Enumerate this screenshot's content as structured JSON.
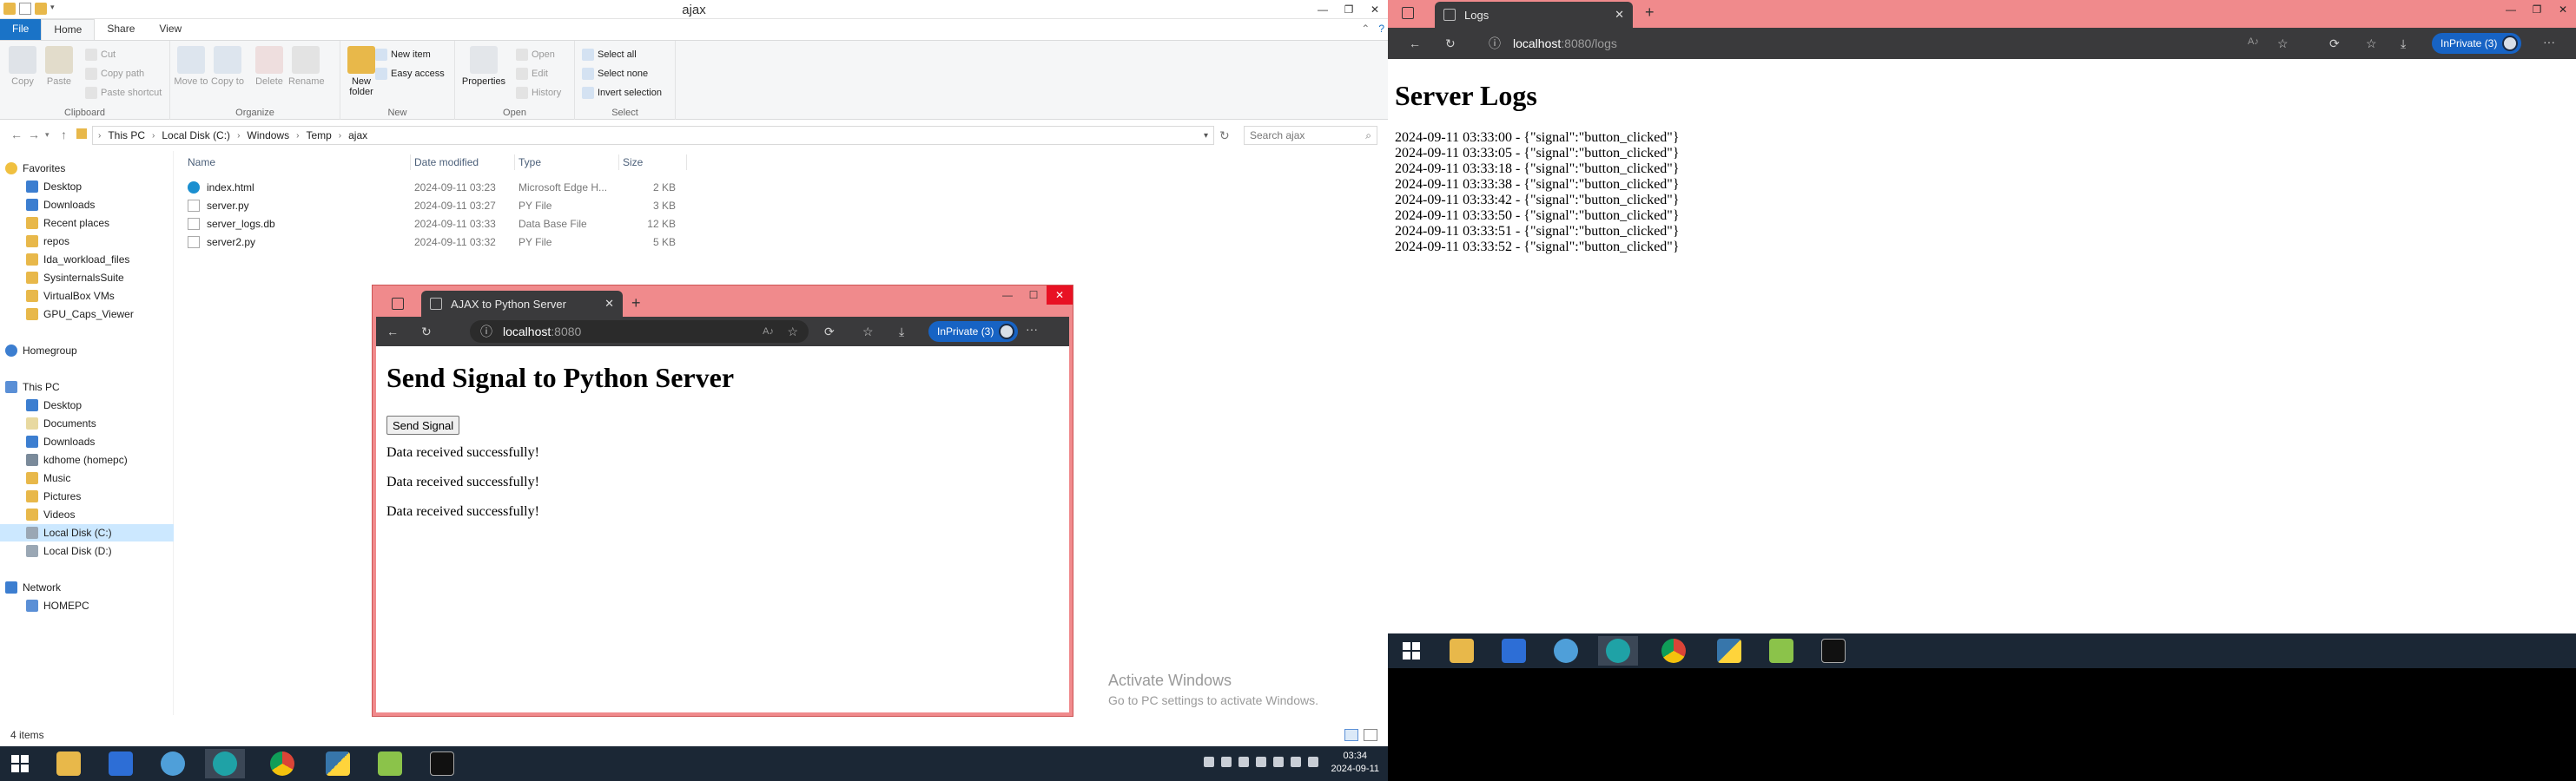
{
  "explorer": {
    "title": "ajax",
    "ribbon_tabs": [
      "File",
      "Home",
      "Share",
      "View"
    ],
    "clipboard": {
      "copy": "Copy",
      "paste": "Paste",
      "cut": "Cut",
      "copy_path": "Copy path",
      "paste_shortcut": "Paste shortcut",
      "label": "Clipboard"
    },
    "organize": {
      "move_to": "Move to",
      "copy_to": "Copy to",
      "delete": "Delete",
      "rename": "Rename",
      "label": "Organize"
    },
    "new_group": {
      "new_folder": "New folder",
      "new_item": "New item",
      "easy_access": "Easy access",
      "label": "New"
    },
    "open_group": {
      "properties": "Properties",
      "open": "Open",
      "edit": "Edit",
      "history": "History",
      "label": "Open"
    },
    "select_group": {
      "select_all": "Select all",
      "select_none": "Select none",
      "invert": "Invert selection",
      "label": "Select"
    },
    "breadcrumb": [
      "This PC",
      "Local Disk (C:)",
      "Windows",
      "Temp",
      "ajax"
    ],
    "search_placeholder": "Search ajax",
    "nav": {
      "favorites": "Favorites",
      "favorites_items": [
        "Desktop",
        "Downloads",
        "Recent places",
        "repos",
        "Ida_workload_files",
        "SysinternalsSuite",
        "VirtualBox VMs",
        "GPU_Caps_Viewer"
      ],
      "homegroup": "Homegroup",
      "this_pc": "This PC",
      "this_pc_items": [
        "Desktop",
        "Documents",
        "Downloads",
        "kdhome (homepc)",
        "Music",
        "Pictures",
        "Videos",
        "Local Disk (C:)",
        "Local Disk (D:)"
      ],
      "network": "Network",
      "network_items": [
        "HOMEPC"
      ]
    },
    "columns": [
      "Name",
      "Date modified",
      "Type",
      "Size"
    ],
    "files": [
      {
        "name": "index.html",
        "date": "2024-09-11 03:23",
        "type": "Microsoft Edge H...",
        "size": "2 KB"
      },
      {
        "name": "server.py",
        "date": "2024-09-11 03:27",
        "type": "PY File",
        "size": "3 KB"
      },
      {
        "name": "server_logs.db",
        "date": "2024-09-11 03:33",
        "type": "Data Base File",
        "size": "12 KB"
      },
      {
        "name": "server2.py",
        "date": "2024-09-11 03:32",
        "type": "PY File",
        "size": "5 KB"
      }
    ],
    "status": "4 items",
    "watermark_title": "Activate Windows",
    "watermark_sub": "Go to PC settings to activate Windows.",
    "clock_time": "03:34",
    "clock_date": "2024-09-11"
  },
  "ajax_browser": {
    "tab_title": "AJAX to Python Server",
    "url_host": "localhost",
    "url_port": ":8080",
    "inprivate": "InPrivate (3)",
    "heading": "Send Signal to Python Server",
    "button": "Send Signal",
    "messages": [
      "Data received successfully!",
      "Data received successfully!",
      "Data received successfully!"
    ]
  },
  "logs_browser": {
    "tab_title": "Logs",
    "url_host": "localhost",
    "url_path": ":8080/logs",
    "inprivate": "InPrivate (3)",
    "heading": "Server Logs",
    "lines": [
      "2024-09-11 03:33:00 - {\"signal\":\"button_clicked\"}",
      "2024-09-11 03:33:05 - {\"signal\":\"button_clicked\"}",
      "2024-09-11 03:33:18 - {\"signal\":\"button_clicked\"}",
      "2024-09-11 03:33:38 - {\"signal\":\"button_clicked\"}",
      "2024-09-11 03:33:42 - {\"signal\":\"button_clicked\"}",
      "2024-09-11 03:33:50 - {\"signal\":\"button_clicked\"}",
      "2024-09-11 03:33:51 - {\"signal\":\"button_clicked\"}",
      "2024-09-11 03:33:52 - {\"signal\":\"button_clicked\"}"
    ]
  },
  "colors": {
    "inprivate_frame": "#f08a8c",
    "taskbar": "#1b2735",
    "edge_toolbar": "#3a3a3c",
    "ribbon_file_tab": "#1a73c7"
  }
}
